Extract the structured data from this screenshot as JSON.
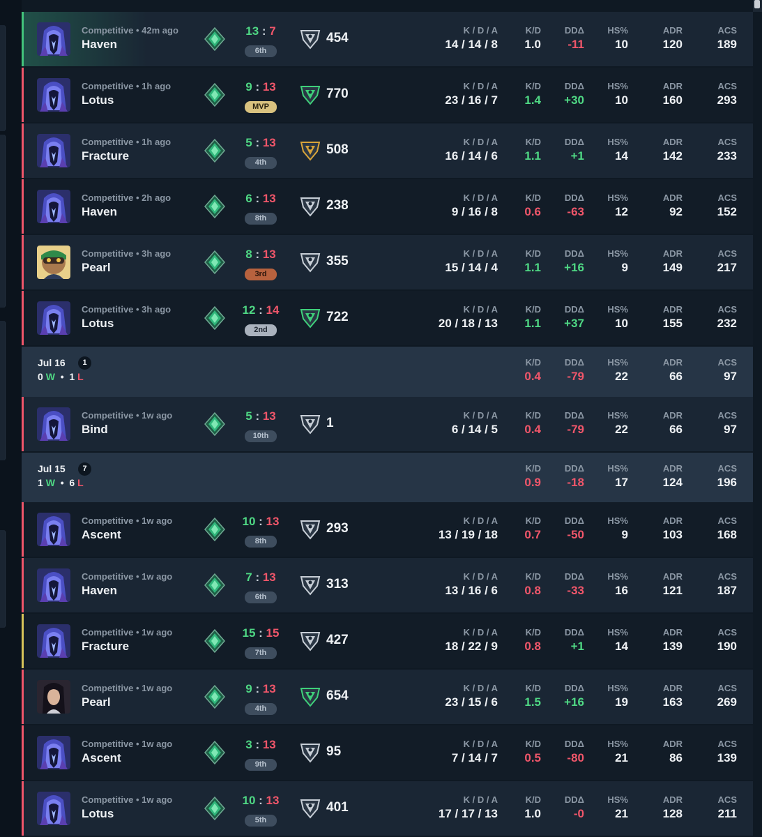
{
  "colors": {
    "win": "#4fd884",
    "loss": "#f0566a",
    "draw": "#d8c45a",
    "background": "#0f1923"
  },
  "labels": {
    "kda": "K / D / A",
    "kd": "K/D",
    "ddd": "DDΔ",
    "hs": "HS%",
    "adr": "ADR",
    "acs": "ACS"
  },
  "icons": {
    "rank": "rank-emerald-icon",
    "rr": "rr-tier-icon",
    "agent": "agent-portrait"
  },
  "matches": [
    {
      "mode": "Competitive • 42m ago",
      "map": "Haven",
      "score_a": "13",
      "score_b": "7",
      "place": "6th",
      "rr": "454",
      "kda": "14 / 14 / 8",
      "kd": "1.0",
      "ddd": "-11",
      "hs": "10",
      "adr": "120",
      "acs": "189",
      "result": "win",
      "agent": "hooded-agent"
    },
    {
      "mode": "Competitive • 1h ago",
      "map": "Lotus",
      "score_a": "9",
      "score_b": "13",
      "place": "MVP",
      "rr": "770",
      "kda": "23 / 16 / 7",
      "kd": "1.4",
      "ddd": "+30",
      "hs": "10",
      "adr": "160",
      "acs": "293",
      "result": "loss",
      "agent": "hooded-agent"
    },
    {
      "mode": "Competitive • 1h ago",
      "map": "Fracture",
      "score_a": "5",
      "score_b": "13",
      "place": "4th",
      "rr": "508",
      "kda": "16 / 14 / 6",
      "kd": "1.1",
      "ddd": "+1",
      "hs": "14",
      "adr": "142",
      "acs": "233",
      "result": "loss",
      "agent": "hooded-agent"
    },
    {
      "mode": "Competitive • 2h ago",
      "map": "Haven",
      "score_a": "6",
      "score_b": "13",
      "place": "8th",
      "rr": "238",
      "kda": "9 / 16 / 8",
      "kd": "0.6",
      "ddd": "-63",
      "hs": "12",
      "adr": "92",
      "acs": "152",
      "result": "loss",
      "agent": "hooded-agent"
    },
    {
      "mode": "Competitive • 3h ago",
      "map": "Pearl",
      "score_a": "8",
      "score_b": "13",
      "place": "3rd",
      "rr": "355",
      "kda": "15 / 14 / 4",
      "kd": "1.1",
      "ddd": "+16",
      "hs": "9",
      "adr": "149",
      "acs": "217",
      "result": "loss",
      "agent": "goggles-agent"
    },
    {
      "mode": "Competitive • 3h ago",
      "map": "Lotus",
      "score_a": "12",
      "score_b": "14",
      "place": "2nd",
      "rr": "722",
      "kda": "20 / 18 / 13",
      "kd": "1.1",
      "ddd": "+37",
      "hs": "10",
      "adr": "155",
      "acs": "232",
      "result": "loss",
      "agent": "hooded-agent"
    },
    {
      "mode": "Competitive • 1w ago",
      "map": "Bind",
      "score_a": "5",
      "score_b": "13",
      "place": "10th",
      "rr": "1",
      "kda": "6 / 14 / 5",
      "kd": "0.4",
      "ddd": "-79",
      "hs": "22",
      "adr": "66",
      "acs": "97",
      "result": "loss",
      "agent": "hooded-agent"
    },
    {
      "mode": "Competitive • 1w ago",
      "map": "Ascent",
      "score_a": "10",
      "score_b": "13",
      "place": "8th",
      "rr": "293",
      "kda": "13 / 19 / 18",
      "kd": "0.7",
      "ddd": "-50",
      "hs": "9",
      "adr": "103",
      "acs": "168",
      "result": "loss",
      "agent": "hooded-agent"
    },
    {
      "mode": "Competitive • 1w ago",
      "map": "Haven",
      "score_a": "7",
      "score_b": "13",
      "place": "6th",
      "rr": "313",
      "kda": "13 / 16 / 6",
      "kd": "0.8",
      "ddd": "-33",
      "hs": "16",
      "adr": "121",
      "acs": "187",
      "result": "loss",
      "agent": "hooded-agent"
    },
    {
      "mode": "Competitive • 1w ago",
      "map": "Fracture",
      "score_a": "15",
      "score_b": "15",
      "place": "7th",
      "rr": "427",
      "kda": "18 / 22 / 9",
      "kd": "0.8",
      "ddd": "+1",
      "hs": "14",
      "adr": "139",
      "acs": "190",
      "result": "draw",
      "agent": "hooded-agent"
    },
    {
      "mode": "Competitive • 1w ago",
      "map": "Pearl",
      "score_a": "9",
      "score_b": "13",
      "place": "4th",
      "rr": "654",
      "kda": "23 / 15 / 6",
      "kd": "1.5",
      "ddd": "+16",
      "hs": "19",
      "adr": "163",
      "acs": "269",
      "result": "loss",
      "agent": "dark-hair-agent"
    },
    {
      "mode": "Competitive • 1w ago",
      "map": "Ascent",
      "score_a": "3",
      "score_b": "13",
      "place": "9th",
      "rr": "95",
      "kda": "7 / 14 / 7",
      "kd": "0.5",
      "ddd": "-80",
      "hs": "21",
      "adr": "86",
      "acs": "139",
      "result": "loss",
      "agent": "hooded-agent"
    },
    {
      "mode": "Competitive • 1w ago",
      "map": "Lotus",
      "score_a": "10",
      "score_b": "13",
      "place": "5th",
      "rr": "401",
      "kda": "17 / 17 / 13",
      "kd": "1.0",
      "ddd": "-0",
      "hs": "21",
      "adr": "128",
      "acs": "211",
      "result": "loss",
      "agent": "hooded-agent"
    }
  ],
  "days": [
    {
      "date": "Jul 16",
      "count": "1",
      "wins": "0",
      "losses": "1",
      "w": "W",
      "l": "L",
      "dot": "•",
      "kd": "0.4",
      "ddd": "-79",
      "hs": "22",
      "adr": "66",
      "acs": "97"
    },
    {
      "date": "Jul 15",
      "count": "7",
      "wins": "1",
      "losses": "6",
      "w": "W",
      "l": "L",
      "dot": "•",
      "kd": "0.9",
      "ddd": "-18",
      "hs": "17",
      "adr": "124",
      "acs": "196"
    }
  ]
}
